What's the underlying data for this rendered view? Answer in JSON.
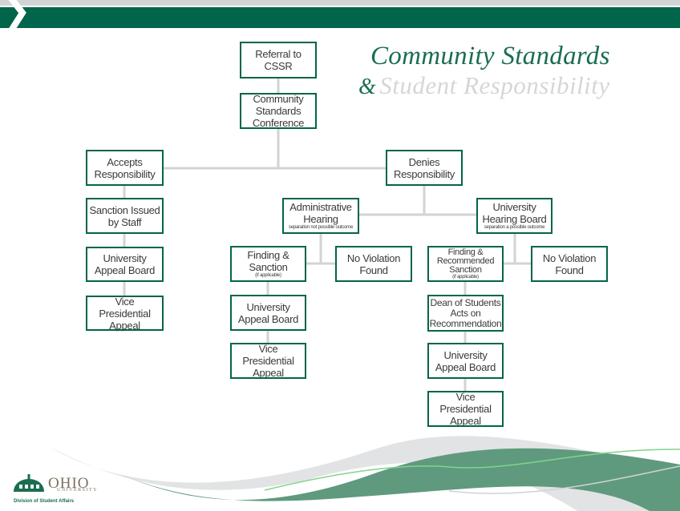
{
  "header": {
    "title_line1": "Community Standards",
    "title_line2_amp": "&",
    "title_line2": "Student Responsibility"
  },
  "colors": {
    "brand_green": "#00654a",
    "connector_gray": "#d1d3d4",
    "wave_green": "#5f9a7e",
    "wave_light_green": "#7fd58a",
    "title_gray": "#d5d6d8"
  },
  "flowchart": {
    "referral": "Referral to CSSR",
    "conference": "Community Standards Conference",
    "accepts": "Accepts Responsibility",
    "denies": "Denies Responsibility",
    "accepts_branch": {
      "sanction": "Sanction Issued by Staff",
      "appeal_board": "University Appeal Board",
      "vp_appeal": "Vice Presidential Appeal"
    },
    "admin_hearing": {
      "title": "Administrative Hearing",
      "note": "separation not possible outcome",
      "finding": "Finding & Sanction",
      "finding_note": "(if applicable)",
      "no_violation": "No Violation Found",
      "appeal_board": "University Appeal Board",
      "vp_appeal": "Vice Presidential Appeal"
    },
    "hearing_board": {
      "title": "University Hearing Board",
      "note": "separation a possible outcome",
      "finding": "Finding & Recommended Sanction",
      "finding_note": "(if applicable)",
      "no_violation": "No Violation Found",
      "dean": "Dean of Students Acts on Recommendation",
      "appeal_board": "University Appeal Board",
      "vp_appeal": "Vice Presidential Appeal"
    }
  },
  "footer": {
    "logo_name": "OHIO",
    "logo_sub": "UNIVERSITY",
    "division": "Division of Student Affairs"
  }
}
